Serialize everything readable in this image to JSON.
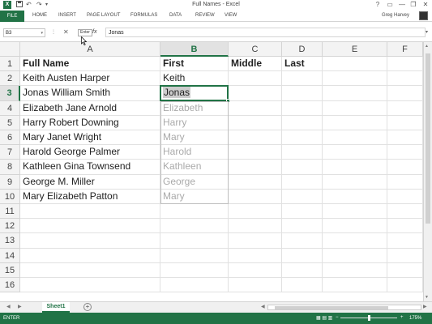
{
  "window": {
    "title": "Full Names - Excel",
    "app_icon": "X",
    "quick_access": {
      "save": "save-icon",
      "undo": "↶",
      "redo": "↷"
    },
    "controls": {
      "help": "?",
      "ribbon_display": "▭",
      "minimize": "—",
      "restore": "❐",
      "close": "✕"
    }
  },
  "ribbon": {
    "file_tab": "FILE",
    "tabs": [
      "HOME",
      "INSERT",
      "PAGE LAYOUT",
      "FORMULAS",
      "DATA",
      "REVIEW",
      "VIEW"
    ],
    "user": "Greg Harvey"
  },
  "formula_bar": {
    "name_box": "B3",
    "cancel": "✕",
    "enter": "✓",
    "fx": "fx",
    "tooltip": "Enter",
    "value": "Jonas"
  },
  "grid": {
    "columns": [
      "A",
      "B",
      "C",
      "D",
      "E",
      "F"
    ],
    "active_column": "B",
    "active_row": 3,
    "rows": [
      1,
      2,
      3,
      4,
      5,
      6,
      7,
      8,
      9,
      10,
      11,
      12,
      13,
      14,
      15,
      16
    ],
    "cells": {
      "A1": "Full Name",
      "B1": "First",
      "C1": "Middle",
      "D1": "Last",
      "A2": "Keith Austen Harper",
      "B2": "Keith",
      "A3": "Jonas William Smith",
      "B3": "Jonas",
      "A4": "Elizabeth Jane Arnold",
      "A5": "Harry Robert Downing",
      "A6": "Mary Janet Wright",
      "A7": "Harold George Palmer",
      "A8": "Kathleen Gina Townsend",
      "A9": "George M. Miller",
      "A10": "Mary Elizabeth Patton"
    },
    "flash_fill_preview": [
      "Elizabeth",
      "Harry",
      "Mary",
      "Harold",
      "Kathleen",
      "George",
      "Mary"
    ]
  },
  "sheets": {
    "tabs": [
      "Sheet1"
    ],
    "active": "Sheet1",
    "add": "+"
  },
  "status": {
    "mode": "ENTER",
    "zoom": "175%",
    "zoom_minus": "−",
    "zoom_plus": "+"
  },
  "colors": {
    "accent": "#217346",
    "ghost_text": "#aaaaaa"
  }
}
